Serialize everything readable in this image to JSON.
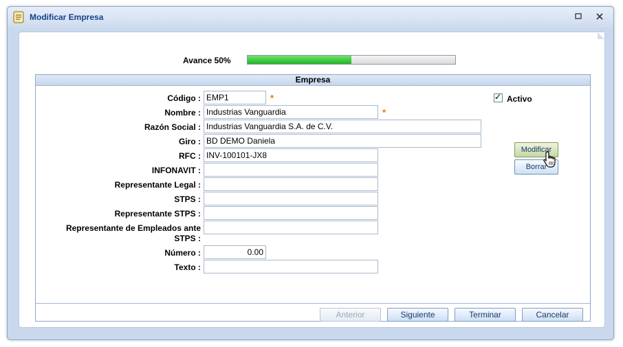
{
  "window": {
    "title": "Modificar Empresa",
    "icon": "form-icon",
    "maximize_icon": "maximize-icon",
    "close_icon": "close-icon"
  },
  "progress": {
    "label": "Avance 50%",
    "percent": 50,
    "fill_color": "#2cbf2c"
  },
  "section": {
    "title": "Empresa"
  },
  "fields": {
    "codigo": {
      "label": "Código :",
      "value": "EMP1",
      "required": "*"
    },
    "nombre": {
      "label": "Nombre :",
      "value": "Industrias Vanguardia",
      "required": "*"
    },
    "razon_social": {
      "label": "Razón Social :",
      "value": "Industrias Vanguardia S.A. de C.V."
    },
    "giro": {
      "label": "Giro :",
      "value": "BD DEMO Daniela"
    },
    "rfc": {
      "label": "RFC :",
      "value": "INV-100101-JX8"
    },
    "infonavit": {
      "label": "INFONAVIT :",
      "value": ""
    },
    "representante_legal": {
      "label": "Representante Legal :",
      "value": ""
    },
    "stps": {
      "label": "STPS :",
      "value": ""
    },
    "representante_stps": {
      "label": "Representante STPS :",
      "value": ""
    },
    "representante_empleados": {
      "label_line1": "Representante de Empleados ante",
      "label_line2": "STPS :",
      "value": ""
    },
    "numero": {
      "label": "Número :",
      "value": "0.00"
    },
    "texto": {
      "label": "Texto :",
      "value": ""
    }
  },
  "activo": {
    "label": "Activo",
    "checked": true
  },
  "side_buttons": {
    "modificar": "Modificar",
    "borrar": "Borrar"
  },
  "footer_buttons": {
    "anterior": "Anterior",
    "siguiente": "Siguiente",
    "terminar": "Terminar",
    "cancelar": "Cancelar"
  },
  "colors": {
    "required_asterisk": "#e07b00",
    "title_text": "#15428b"
  }
}
